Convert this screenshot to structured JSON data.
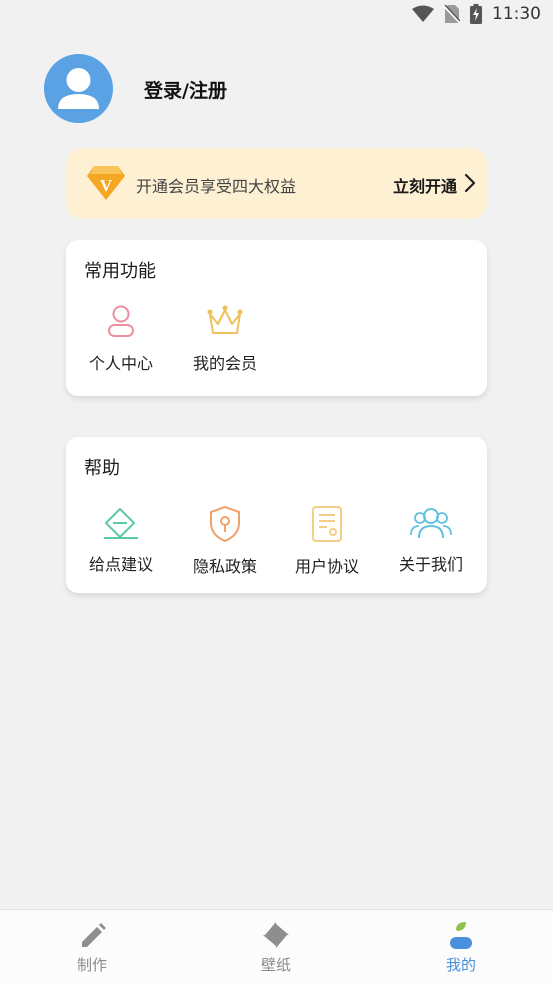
{
  "status_bar": {
    "time": "11:30"
  },
  "profile": {
    "login_label": "登录/注册"
  },
  "vip_banner": {
    "description": "开通会员享受四大权益",
    "action_label": "立刻开通",
    "badge_letter": "V"
  },
  "common_functions": {
    "title": "常用功能",
    "items": [
      {
        "label": "个人中心",
        "icon": "person-icon"
      },
      {
        "label": "我的会员",
        "icon": "crown-icon"
      }
    ]
  },
  "help": {
    "title": "帮助",
    "items": [
      {
        "label": "给点建议",
        "icon": "feedback-icon"
      },
      {
        "label": "隐私政策",
        "icon": "shield-lock-icon"
      },
      {
        "label": "用户协议",
        "icon": "agreement-icon"
      },
      {
        "label": "关于我们",
        "icon": "group-icon"
      }
    ]
  },
  "bottom_nav": {
    "items": [
      {
        "label": "制作",
        "icon": "pencil-icon"
      },
      {
        "label": "壁纸",
        "icon": "pinwheel-icon"
      },
      {
        "label": "我的",
        "icon": "profile-tab-icon",
        "active": true
      }
    ]
  },
  "colors": {
    "accent_blue": "#4a8fdb",
    "avatar_blue": "#5aa2e4",
    "vip_background": "#fdf0d3",
    "vip_gold": "#f5a623",
    "page_background": "#f1f1f1"
  }
}
